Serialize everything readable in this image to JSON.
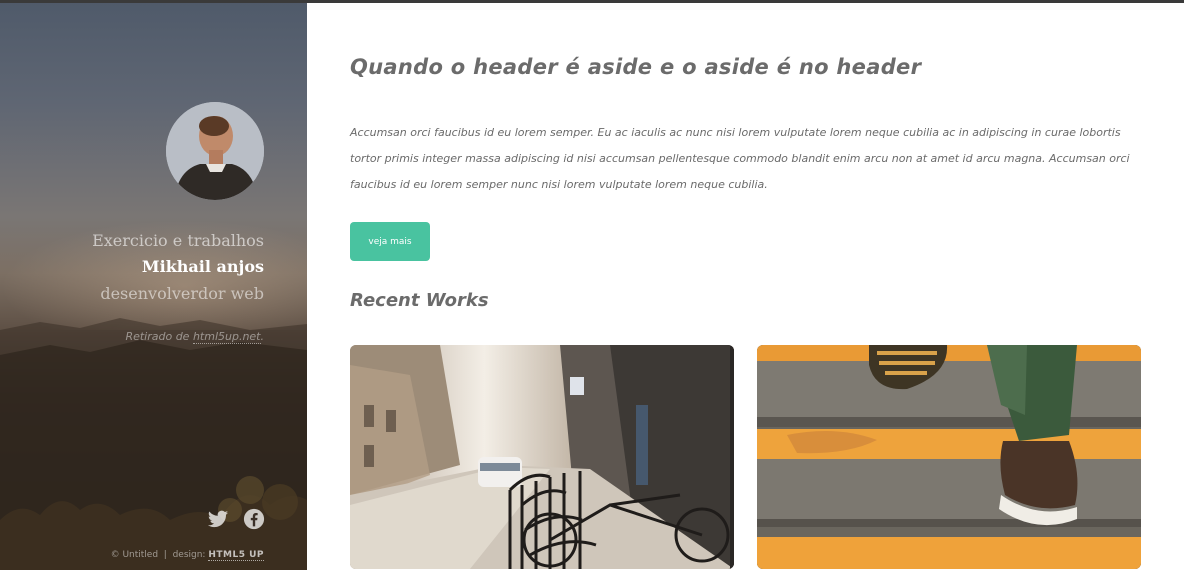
{
  "sidebar": {
    "subtitle": "Exercicio e trabalhos",
    "name": "Mikhail anjos",
    "role": "desenvolverdor web",
    "credit_prefix": "Retirado de ",
    "credit_link": "html5up.net",
    "credit_suffix": ".",
    "social_icons": [
      "twitter-icon",
      "facebook-icon"
    ],
    "footer": {
      "copyright": "© Untitled",
      "separator": "|",
      "design_label": "design:",
      "design_link": "HTML5 UP"
    }
  },
  "main": {
    "headline": "Quando o header é aside e o aside é no header",
    "paragraph": "Accumsan orci faucibus id eu lorem semper. Eu ac iaculis ac nunc nisi lorem vulputate lorem neque cubilia ac in adipiscing in curae lobortis tortor primis integer massa adipiscing id nisi accumsan pellentesque commodo blandit enim arcu non at amet id arcu magna. Accumsan orci faucibus id eu lorem semper nunc nisi lorem vulputate lorem neque cubilia.",
    "more_button": "veja mais",
    "recent_works_title": "Recent Works",
    "works": [
      "street-bicycles-photo",
      "stairs-sneaker-photo"
    ]
  },
  "colors": {
    "accent": "#49c3a0",
    "text": "#6b6b6b",
    "background": "#ffffff"
  }
}
